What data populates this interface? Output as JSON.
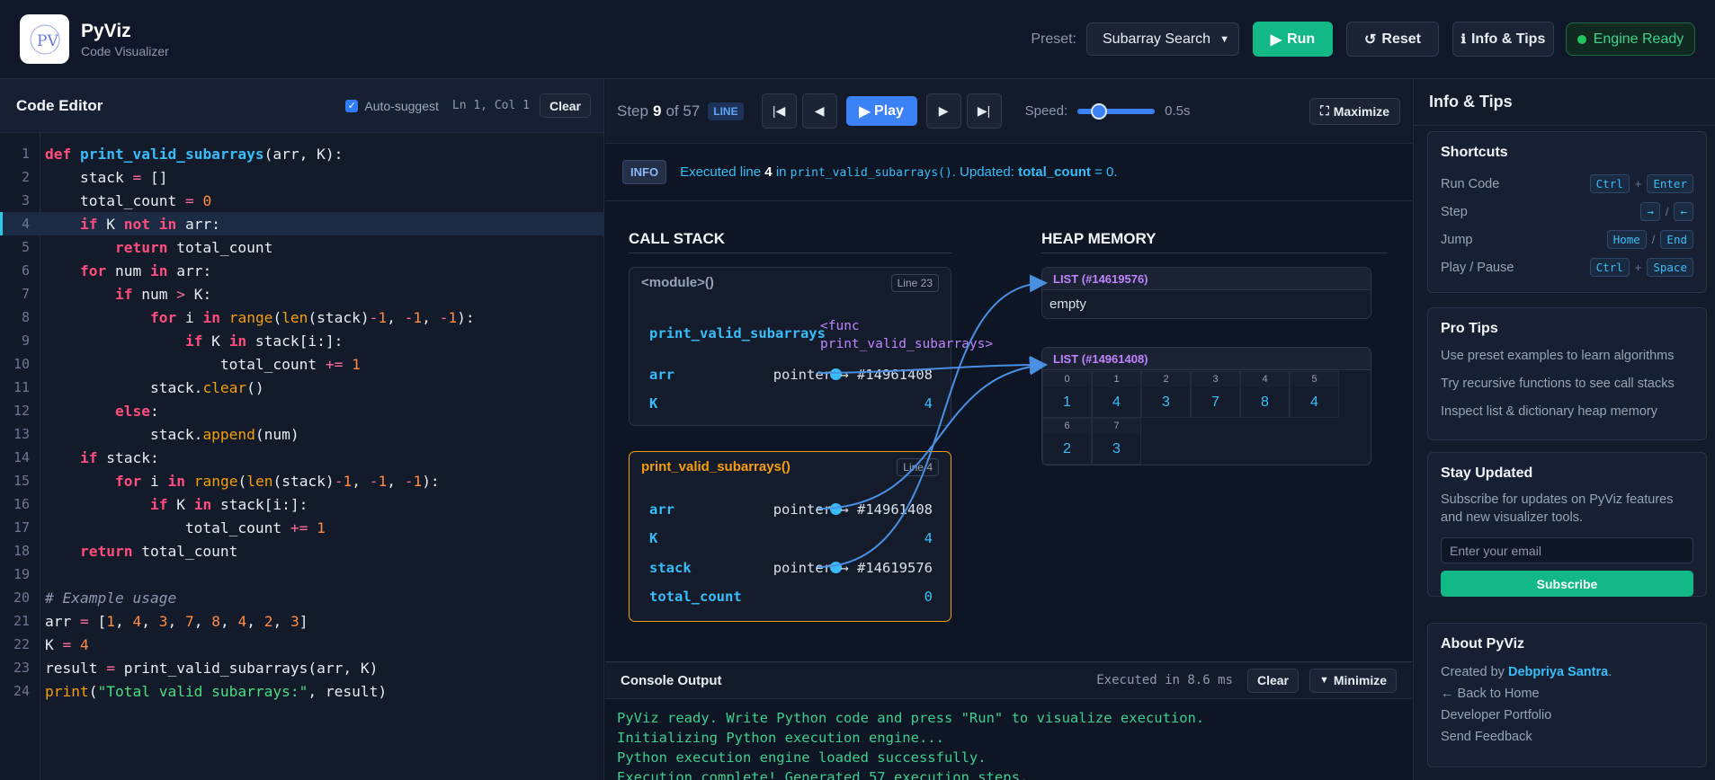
{
  "header": {
    "app_title": "PyViz",
    "app_subtitle": "Code Visualizer",
    "logo_text": "PV",
    "preset_label": "Preset:",
    "preset_value": "Subarray Search",
    "run_label": "Run",
    "reset_label": "Reset",
    "info_label": "Info & Tips",
    "engine_status": "Engine Ready"
  },
  "editor": {
    "title": "Code Editor",
    "auto_suggest_label": "Auto-suggest",
    "auto_suggest_checked": true,
    "cursor_pos": "Ln 1, Col 1",
    "clear_label": "Clear",
    "highlighted_line": 4,
    "lines": [
      "def print_valid_subarrays(arr, K):",
      "    stack = []",
      "    total_count = 0",
      "    if K not in arr:",
      "        return total_count",
      "    for num in arr:",
      "        if num > K:",
      "            for i in range(len(stack)-1, -1, -1):",
      "                if K in stack[i:]:",
      "                    total_count += 1",
      "            stack.clear()",
      "        else:",
      "            stack.append(num)",
      "    if stack:",
      "        for i in range(len(stack)-1, -1, -1):",
      "            if K in stack[i:]:",
      "                total_count += 1",
      "    return total_count",
      "",
      "# Example usage",
      "arr = [1, 4, 3, 7, 8, 4, 2, 3]",
      "K = 4",
      "result = print_valid_subarrays(arr, K)",
      "print(\"Total valid subarrays:\", result)"
    ]
  },
  "controls": {
    "step_label": "Step",
    "step_current": "9",
    "step_total": "of 57",
    "step_type": "LINE",
    "play_label": "Play",
    "speed_label": "Speed:",
    "speed_value": "0.5s",
    "speed_fraction": 0.17,
    "maximize_label": "Maximize"
  },
  "info": {
    "badge": "INFO",
    "text_prefix": "Executed line",
    "line_no": "4",
    "text_in": "in",
    "func": "print_valid_subarrays()",
    "text_updated": ". Updated:",
    "var": "total_count",
    "text_suffix": "= 0."
  },
  "call_stack": {
    "title": "CALL STACK",
    "frames": [
      {
        "name": "<module>()",
        "line": "Line 23",
        "vars": [
          {
            "name": "print_valid_subarrays",
            "value": "<func print_valid_subarrays>"
          },
          {
            "name": "arr",
            "value": "pointer → #14961408"
          },
          {
            "name": "K",
            "value": "4"
          }
        ]
      },
      {
        "name": "print_valid_subarrays()",
        "line": "Line 4",
        "vars": [
          {
            "name": "arr",
            "value": "pointer → #14961408"
          },
          {
            "name": "K",
            "value": "4"
          },
          {
            "name": "stack",
            "value": "pointer → #14619576"
          },
          {
            "name": "total_count",
            "value": "0"
          }
        ]
      }
    ]
  },
  "heap": {
    "title": "HEAP MEMORY",
    "objects": [
      {
        "label": "LIST (#14619576)",
        "empty_text": "empty"
      },
      {
        "label": "LIST (#14961408)",
        "indices": [
          "0",
          "1",
          "2",
          "3",
          "4",
          "5",
          "6",
          "7"
        ],
        "values": [
          "1",
          "4",
          "3",
          "7",
          "8",
          "4",
          "2",
          "3"
        ]
      }
    ]
  },
  "console": {
    "title": "Console Output",
    "exec_time": "Executed in 8.6 ms",
    "clear_label": "Clear",
    "minimize_label": "Minimize",
    "lines": [
      "PyViz ready. Write Python code and press \"Run\" to visualize execution.",
      "Initializing Python execution engine...",
      "Python execution engine loaded successfully.",
      "Execution complete! Generated 57 execution steps."
    ]
  },
  "sidebar": {
    "title": "Info & Tips",
    "shortcuts": {
      "title": "Shortcuts",
      "items": [
        {
          "label": "Run Code",
          "k1": "Ctrl",
          "sep": "+",
          "k2": "Enter"
        },
        {
          "label": "Step",
          "k1": "→",
          "sep": "/",
          "k2": "←"
        },
        {
          "label": "Jump",
          "k1": "Home",
          "sep": "/",
          "k2": "End"
        },
        {
          "label": "Play / Pause",
          "k1": "Ctrl",
          "sep": "+",
          "k2": "Space"
        }
      ]
    },
    "pro_tips": {
      "title": "Pro Tips",
      "items": [
        "Use preset examples to learn algorithms",
        "Try recursive functions to see call stacks",
        "Inspect list & dictionary heap memory"
      ]
    },
    "updates": {
      "title": "Stay Updated",
      "text": "Subscribe for updates on PyViz features and new visualizer tools.",
      "email_placeholder": "Enter your email",
      "subscribe_label": "Subscribe"
    },
    "about": {
      "title": "About PyViz",
      "created_prefix": "Created by",
      "author": "Debpriya Santra",
      "created_suffix": ".",
      "links": [
        "← Back to Home",
        "Developer Portfolio",
        "Send Feedback"
      ]
    }
  },
  "colors": {
    "accent": "#3b82f6",
    "success": "#12b886",
    "active_frame": "#f59e0b",
    "pointer": "#38bdf8"
  }
}
